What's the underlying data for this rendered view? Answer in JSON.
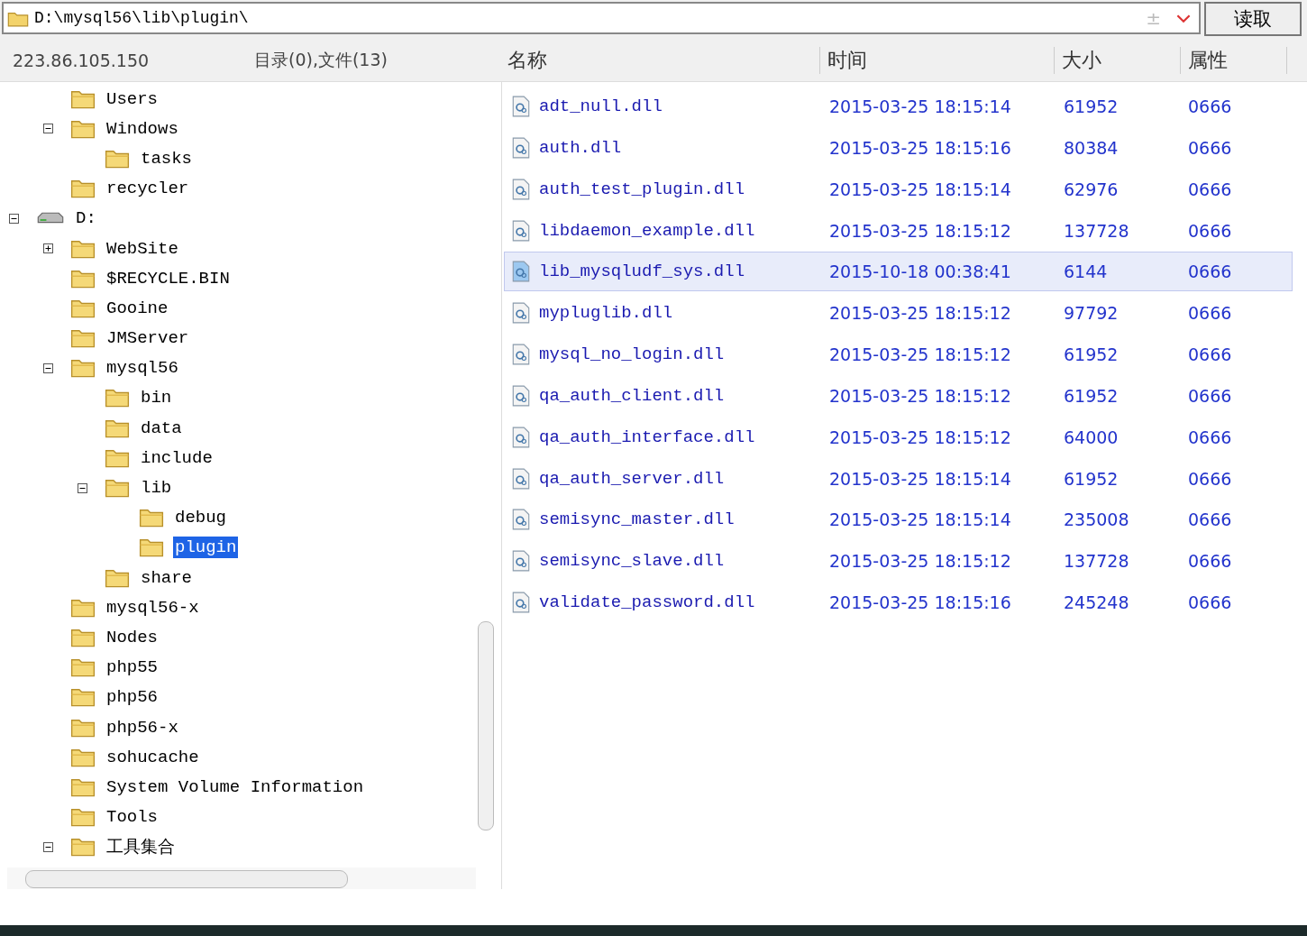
{
  "path_bar": {
    "value": "D:\\mysql56\\lib\\plugin\\",
    "toggle": "±",
    "read_button": "读取"
  },
  "left_header": {
    "host": "223.86.105.150",
    "summary": "目录(0),文件(13)"
  },
  "tree": [
    {
      "children": [
        {
          "label": "Users",
          "kind": "folder"
        },
        {
          "label": "Windows",
          "kind": "folder",
          "expanded": true,
          "children": [
            {
              "label": "tasks",
              "kind": "folder"
            }
          ]
        },
        {
          "label": "recycler",
          "kind": "folder"
        }
      ]
    },
    {
      "label": "D:",
      "kind": "drive",
      "expanded": true,
      "children": [
        {
          "label": "WebSite",
          "kind": "folder",
          "expanded": false
        },
        {
          "label": "$RECYCLE.BIN",
          "kind": "folder"
        },
        {
          "label": "Gooine",
          "kind": "folder"
        },
        {
          "label": "JMServer",
          "kind": "folder"
        },
        {
          "label": "mysql56",
          "kind": "folder",
          "expanded": true,
          "children": [
            {
              "label": "bin",
              "kind": "folder"
            },
            {
              "label": "data",
              "kind": "folder"
            },
            {
              "label": "include",
              "kind": "folder"
            },
            {
              "label": "lib",
              "kind": "folder",
              "expanded": true,
              "children": [
                {
                  "label": "debug",
                  "kind": "folder"
                },
                {
                  "label": "plugin",
                  "kind": "folder",
                  "selected": true
                }
              ]
            },
            {
              "label": "share",
              "kind": "folder"
            }
          ]
        },
        {
          "label": "mysql56-x",
          "kind": "folder"
        },
        {
          "label": "Nodes",
          "kind": "folder"
        },
        {
          "label": "php55",
          "kind": "folder"
        },
        {
          "label": "php56",
          "kind": "folder"
        },
        {
          "label": "php56-x",
          "kind": "folder"
        },
        {
          "label": "sohucache",
          "kind": "folder"
        },
        {
          "label": "System Volume Information",
          "kind": "folder"
        },
        {
          "label": "Tools",
          "kind": "folder"
        },
        {
          "label": "工具集合",
          "kind": "folder",
          "expanded": true
        }
      ]
    }
  ],
  "columns": [
    "名称",
    "时间",
    "大小",
    "属性"
  ],
  "files": [
    {
      "name": "adt_null.dll",
      "time": "2015-03-25 18:15:14",
      "size": "61952",
      "attr": "0666",
      "selected": false
    },
    {
      "name": "auth.dll",
      "time": "2015-03-25 18:15:16",
      "size": "80384",
      "attr": "0666",
      "selected": false
    },
    {
      "name": "auth_test_plugin.dll",
      "time": "2015-03-25 18:15:14",
      "size": "62976",
      "attr": "0666",
      "selected": false
    },
    {
      "name": "libdaemon_example.dll",
      "time": "2015-03-25 18:15:12",
      "size": "137728",
      "attr": "0666",
      "selected": false
    },
    {
      "name": "lib_mysqludf_sys.dll",
      "time": "2015-10-18 00:38:41",
      "size": "6144",
      "attr": "0666",
      "selected": true
    },
    {
      "name": "mypluglib.dll",
      "time": "2015-03-25 18:15:12",
      "size": "97792",
      "attr": "0666",
      "selected": false
    },
    {
      "name": "mysql_no_login.dll",
      "time": "2015-03-25 18:15:12",
      "size": "61952",
      "attr": "0666",
      "selected": false
    },
    {
      "name": "qa_auth_client.dll",
      "time": "2015-03-25 18:15:12",
      "size": "61952",
      "attr": "0666",
      "selected": false
    },
    {
      "name": "qa_auth_interface.dll",
      "time": "2015-03-25 18:15:12",
      "size": "64000",
      "attr": "0666",
      "selected": false
    },
    {
      "name": "qa_auth_server.dll",
      "time": "2015-03-25 18:15:14",
      "size": "61952",
      "attr": "0666",
      "selected": false
    },
    {
      "name": "semisync_master.dll",
      "time": "2015-03-25 18:15:14",
      "size": "235008",
      "attr": "0666",
      "selected": false
    },
    {
      "name": "semisync_slave.dll",
      "time": "2015-03-25 18:15:12",
      "size": "137728",
      "attr": "0666",
      "selected": false
    },
    {
      "name": "validate_password.dll",
      "time": "2015-03-25 18:15:16",
      "size": "245248",
      "attr": "0666",
      "selected": false
    }
  ]
}
